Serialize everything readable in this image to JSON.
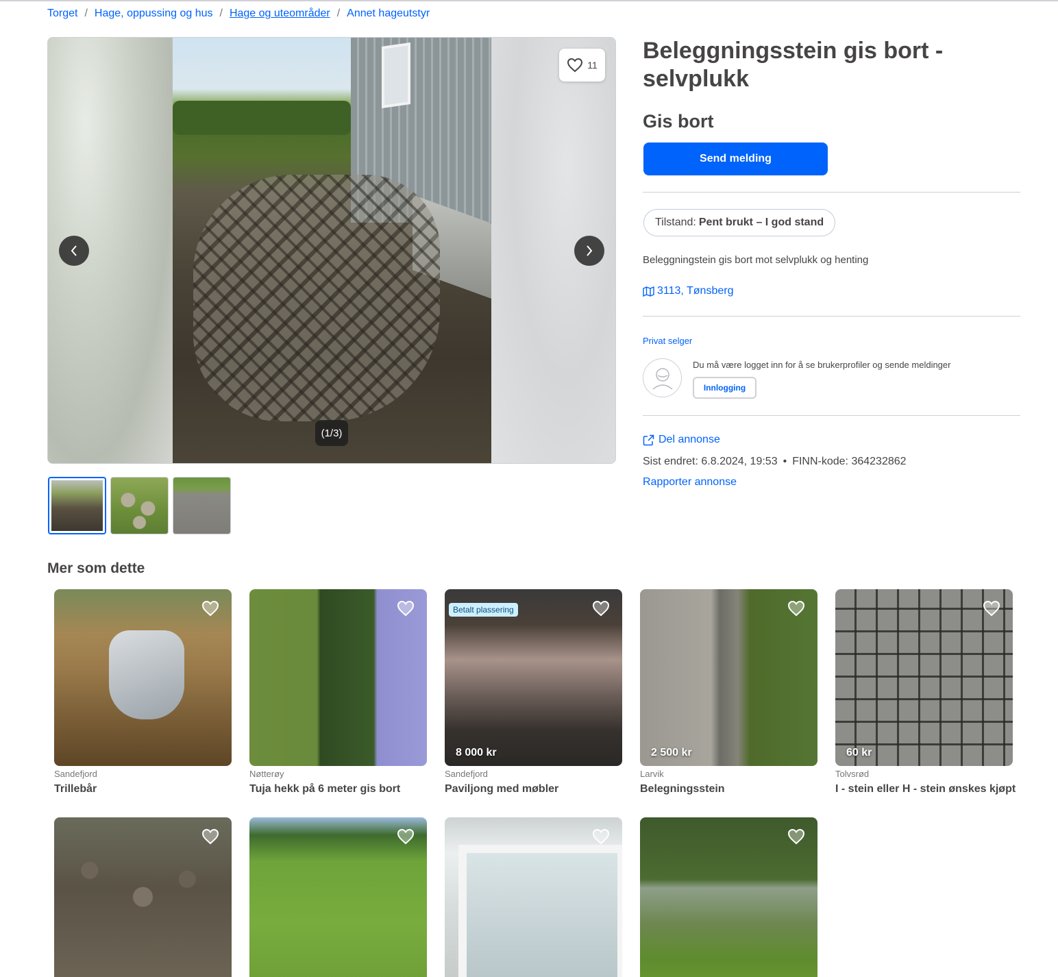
{
  "breadcrumb": {
    "items": [
      "Torget",
      "Hage, oppussing og hus",
      "Hage og uteområder",
      "Annet hageutstyr"
    ],
    "separator": "/"
  },
  "gallery": {
    "favorite_count": "11",
    "counter": "(1/3)",
    "thumbnails": 3,
    "active_thumbnail": 1
  },
  "listing": {
    "title": "Beleggningsstein gis bort - selvplukk",
    "price": "Gis bort",
    "send_button": "Send melding",
    "condition_label": "Tilstand:",
    "condition_value": "Pent brukt – I god stand",
    "description": "Beleggningstein gis bort mot selvplukk og henting",
    "location": "3113, Tønsberg"
  },
  "seller": {
    "label": "Privat selger",
    "login_note": "Du må være logget inn for å se brukerprofiler og sende meldinger",
    "login_button": "Innlogging"
  },
  "footer_meta": {
    "share": "Del annonse",
    "last_changed": "Sist endret: 6.8.2024, 19:53",
    "finn_code": "FINN-kode: 364232862",
    "report": "Rapporter annonse"
  },
  "recommendations": {
    "title": "Mer som dette",
    "items": [
      {
        "location": "Sandefjord",
        "title": "Trillebår",
        "price": ""
      },
      {
        "location": "Nøtterøy",
        "title": "Tuja hekk på 6 meter gis bort",
        "price": ""
      },
      {
        "location": "Sandefjord",
        "title": "Paviljong med møbler",
        "price": "8 000 kr",
        "badge": "Betalt plassering"
      },
      {
        "location": "Larvik",
        "title": "Belegningsstein",
        "price": "2 500 kr"
      },
      {
        "location": "Tolvsrød",
        "title": "I - stein eller H - stein ønskes kjøpt",
        "price": "60 kr"
      },
      {
        "location": "",
        "title": "",
        "price": ""
      },
      {
        "location": "",
        "title": "",
        "price": ""
      },
      {
        "location": "",
        "title": "",
        "price": ""
      },
      {
        "location": "",
        "title": "",
        "price": ""
      }
    ]
  },
  "colors": {
    "accent": "#0063fb",
    "text": "#474445",
    "muted": "#767676",
    "border": "#d0d0d6",
    "badge_bg": "#ccf0ff"
  },
  "icons": [
    "heart-icon",
    "chevron-left-icon",
    "chevron-right-icon",
    "map-icon",
    "share-icon",
    "user-avatar-icon"
  ]
}
